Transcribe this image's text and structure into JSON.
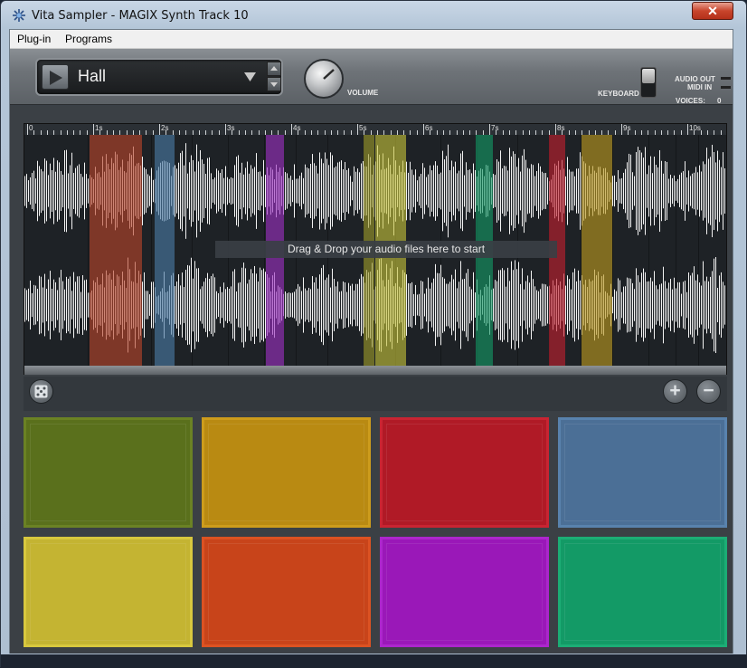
{
  "window": {
    "title": "Vita Sampler - MAGIX Synth Track 10",
    "close_label": "✕"
  },
  "menu": {
    "items": [
      "Plug-in",
      "Programs"
    ]
  },
  "header": {
    "preset_name": "Hall",
    "volume_label": "VOLUME",
    "keyboard_label": "KEYBOARD",
    "audio_out_label": "AUDIO OUT",
    "midi_in_label": "MIDI IN",
    "voices_label": "VOICES:",
    "voices_value": "0"
  },
  "ruler": {
    "labels": [
      "0",
      "1s",
      "2s",
      "3s",
      "4s",
      "5s",
      "6s",
      "7s",
      "8s",
      "9s",
      "10s"
    ]
  },
  "waveform": {
    "drop_hint": "Drag & Drop your audio files here to start",
    "regions": [
      {
        "color": "#b9432a"
      },
      {
        "color": "#4a7aa6"
      },
      {
        "color": "#9c2ec4"
      },
      {
        "color": "#9c9a2a"
      },
      {
        "color": "#c5c23a"
      },
      {
        "color": "#139a66"
      },
      {
        "color": "#c41e2e"
      },
      {
        "color": "#bd9a1e"
      }
    ]
  },
  "tools": {
    "dice_icon": "dice-icon",
    "zoom_in": "+",
    "zoom_out": "−"
  },
  "pads": [
    {
      "name": "pad-1",
      "color": "#5a701c",
      "border": "#6b8224"
    },
    {
      "name": "pad-2",
      "color": "#b98a12",
      "border": "#cd9c1c"
    },
    {
      "name": "pad-3",
      "color": "#b01a26",
      "border": "#c92432"
    },
    {
      "name": "pad-4",
      "color": "#4b6f96",
      "border": "#5982ad"
    },
    {
      "name": "pad-5",
      "color": "#c4b432",
      "border": "#d8c83e"
    },
    {
      "name": "pad-6",
      "color": "#c8441a",
      "border": "#dc5222"
    },
    {
      "name": "pad-7",
      "color": "#9a18b8",
      "border": "#ac26cc"
    },
    {
      "name": "pad-8",
      "color": "#139a66",
      "border": "#1cad75"
    }
  ],
  "colors": {
    "accent": "#6e7378",
    "panel": "#3b4045"
  }
}
